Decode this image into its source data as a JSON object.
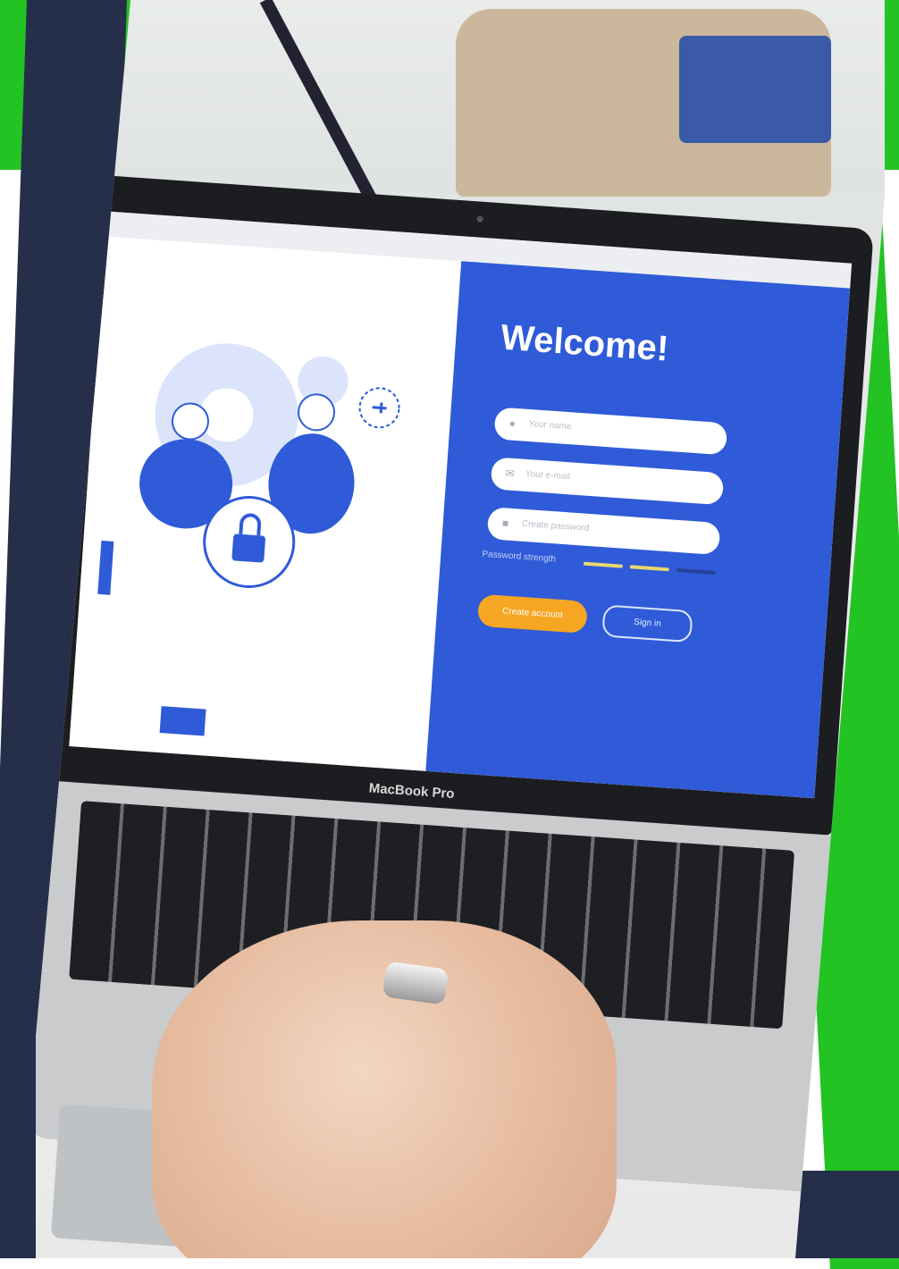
{
  "laptop_label": "MacBook Pro",
  "screen": {
    "url": "",
    "welcome": "Welcome!",
    "fields": [
      {
        "icon": "user-icon",
        "placeholder": "Your name"
      },
      {
        "icon": "email-icon",
        "placeholder": "Your e-mail"
      },
      {
        "icon": "lock-icon",
        "placeholder": "Create password"
      }
    ],
    "password_strength_label": "Password strength",
    "strength_level": 0.67,
    "create_button": "Create account",
    "signin_button": "Sign in"
  },
  "colors": {
    "brand_green": "#22c322",
    "navy": "#252f4a",
    "screen_blue": "#2f5bd8",
    "button_orange": "#f6a623"
  }
}
